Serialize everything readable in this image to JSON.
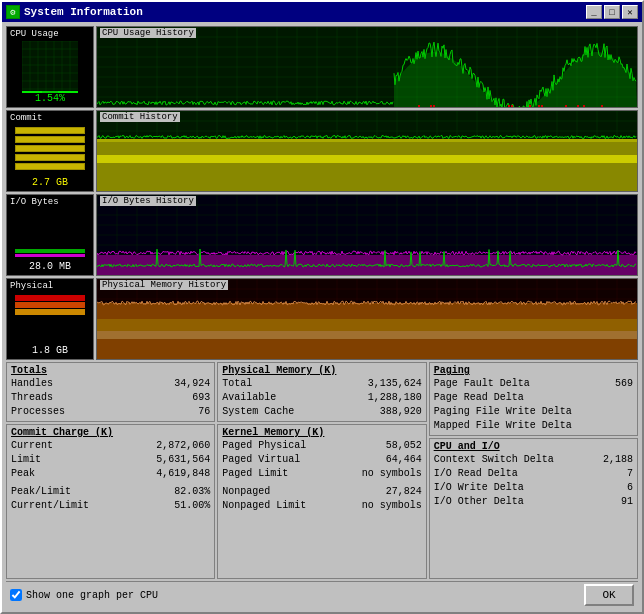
{
  "window": {
    "title": "System Information",
    "icon": "★"
  },
  "titlebar_buttons": {
    "minimize": "_",
    "maximize": "□",
    "close": "✕"
  },
  "graphs": {
    "cpu": {
      "label": "CPU Usage",
      "history_label": "CPU Usage History",
      "value": "1.54%",
      "bar_pct": 2
    },
    "commit": {
      "label": "Commit",
      "history_label": "Commit History",
      "value": "2.7 GB"
    },
    "io": {
      "label": "I/O Bytes",
      "history_label": "I/O Bytes History",
      "value": "28.0 MB"
    },
    "physical": {
      "label": "Physical",
      "history_label": "Physical Memory History",
      "value": "1.8 GB"
    }
  },
  "totals": {
    "title": "Totals",
    "handles_label": "Handles",
    "handles_value": "34,924",
    "threads_label": "Threads",
    "threads_value": "693",
    "processes_label": "Processes",
    "processes_value": "76"
  },
  "commit_charge": {
    "title": "Commit Charge (K)",
    "current_label": "Current",
    "current_value": "2,872,060",
    "limit_label": "Limit",
    "limit_value": "5,631,564",
    "peak_label": "Peak",
    "peak_value": "4,619,848",
    "peak_limit_label": "Peak/Limit",
    "peak_limit_value": "82.03%",
    "current_limit_label": "Current/Limit",
    "current_limit_value": "51.00%"
  },
  "physical_memory": {
    "title": "Physical Memory (K)",
    "total_label": "Total",
    "total_value": "3,135,624",
    "available_label": "Available",
    "available_value": "1,288,180",
    "system_cache_label": "System Cache",
    "system_cache_value": "388,920"
  },
  "kernel_memory": {
    "title": "Kernel Memory (K)",
    "paged_physical_label": "Paged Physical",
    "paged_physical_value": "58,052",
    "paged_virtual_label": "Paged Virtual",
    "paged_virtual_value": "64,464",
    "paged_limit_label": "Paged Limit",
    "paged_limit_value": "no symbols",
    "nonpaged_label": "Nonpaged",
    "nonpaged_value": "27,824",
    "nonpaged_limit_label": "Nonpaged Limit",
    "nonpaged_limit_value": "no symbols"
  },
  "paging": {
    "title": "Paging",
    "page_fault_delta_label": "Page Fault Delta",
    "page_fault_delta_value": "569",
    "page_read_delta_label": "Page Read Delta",
    "page_read_delta_value": "",
    "paging_file_write_label": "Paging File Write Delta",
    "paging_file_write_value": "",
    "mapped_file_write_label": "Mapped File Write Delta",
    "mapped_file_write_value": ""
  },
  "cpu_io": {
    "title": "CPU and I/O",
    "context_switch_label": "Context Switch Delta",
    "context_switch_value": "2,188",
    "io_read_label": "I/O Read Delta",
    "io_read_value": "7",
    "io_write_label": "I/O Write Delta",
    "io_write_value": "6",
    "io_other_label": "I/O Other Delta",
    "io_other_value": "91"
  },
  "bottom": {
    "checkbox_label": "Show one graph per CPU",
    "ok_button": "OK"
  }
}
